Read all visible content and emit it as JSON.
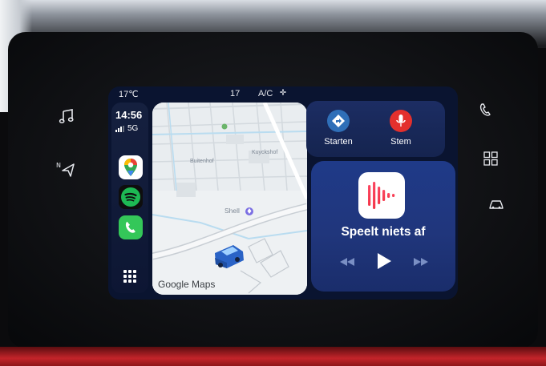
{
  "colors": {
    "screen_bg": "#0a1430",
    "card_bg": "#1c2d63",
    "siri_start": "#2f6fb8",
    "siri_voice": "#e3302d",
    "spotify": "#1db954",
    "phone": "#34c759",
    "trim_red": "#c4242a"
  },
  "status_bar": {
    "temperature_label": "17℃",
    "fan_level": "17",
    "ac_label": "A/C",
    "ac_icon": "fan-icon"
  },
  "dock": {
    "time": "14:56",
    "network": "5G",
    "apps": [
      {
        "name": "Google Maps",
        "icon": "google-maps-icon"
      },
      {
        "name": "Spotify",
        "icon": "spotify-icon"
      },
      {
        "name": "Telefoon",
        "icon": "phone-icon"
      }
    ],
    "app_grid_icon": "app-grid-icon"
  },
  "map": {
    "logo_text": "Google Maps",
    "streets": [
      "Buitenhof",
      "Kuyckshof",
      "Shell"
    ],
    "poi": "Shell"
  },
  "siri": {
    "start_label": "Starten",
    "voice_label": "Stem"
  },
  "now_playing": {
    "status": "Speelt niets af",
    "controls": [
      "rewind-icon",
      "play-icon",
      "fast-forward-icon"
    ]
  },
  "hardware_buttons": {
    "left": [
      "music-note-icon",
      "navigation-icon"
    ],
    "right": [
      "phone-handset-icon",
      "grid-menu-icon",
      "car-icon"
    ]
  }
}
